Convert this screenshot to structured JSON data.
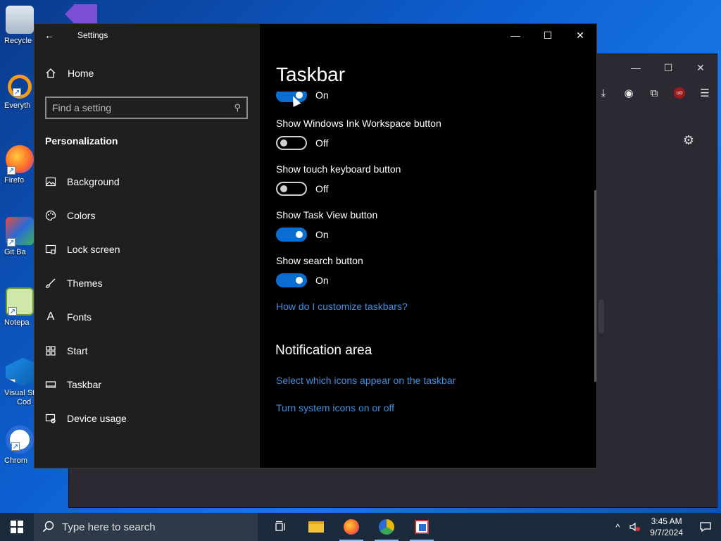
{
  "desktop": {
    "icons": [
      {
        "label": "Recycle"
      },
      {
        "label": "Everyth"
      },
      {
        "label": "Firefo"
      },
      {
        "label": "Git Ba"
      },
      {
        "label": "Notepa"
      },
      {
        "label": "Visual St",
        "label2": "Cod"
      },
      {
        "label": "Chrom"
      }
    ]
  },
  "settings": {
    "window_title": "Settings",
    "home_label": "Home",
    "search_placeholder": "Find a setting",
    "section_title": "Personalization",
    "nav": [
      {
        "label": "Background",
        "icon": "picture-icon"
      },
      {
        "label": "Colors",
        "icon": "palette-icon"
      },
      {
        "label": "Lock screen",
        "icon": "lock-screen-icon"
      },
      {
        "label": "Themes",
        "icon": "brush-icon"
      },
      {
        "label": "Fonts",
        "icon": "font-icon"
      },
      {
        "label": "Start",
        "icon": "start-grid-icon"
      },
      {
        "label": "Taskbar",
        "icon": "taskbar-icon"
      },
      {
        "label": "Device usage",
        "icon": "device-usage-icon"
      }
    ],
    "page_title": "Taskbar",
    "settings_list": [
      {
        "label": "",
        "state": "On"
      },
      {
        "label": "Show Windows Ink Workspace button",
        "state": "Off"
      },
      {
        "label": "Show touch keyboard button",
        "state": "Off"
      },
      {
        "label": "Show Task View button",
        "state": "On"
      },
      {
        "label": "Show search button",
        "state": "On"
      }
    ],
    "help_link": "How do I customize taskbars?",
    "notification_heading": "Notification area",
    "notification_links": [
      "Select which icons appear on the taskbar",
      "Turn system icons on or off"
    ]
  },
  "taskbar": {
    "search_placeholder": "Type here to search",
    "time": "3:45 AM",
    "date": "9/7/2024"
  },
  "colors": {
    "accent": "#0a6ed1",
    "link": "#3f8fe0"
  }
}
